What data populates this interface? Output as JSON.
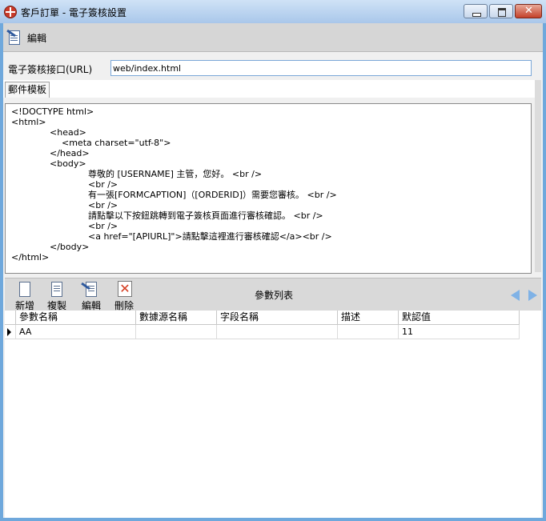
{
  "window": {
    "title": "客戶訂單 - 電子簽核設置"
  },
  "toolbar": {
    "edit_label": "編輯"
  },
  "url": {
    "label": "電子簽核接口(URL)",
    "value": "web/index.html"
  },
  "tabs": [
    {
      "label": "郵件模板"
    }
  ],
  "template_lines": [
    "<!DOCTYPE html>",
    "<html>",
    "<head>",
    "<meta charset=\"utf-8\">",
    "</head>",
    "<body>",
    "尊敬的 [USERNAME] 主管，您好。 <br />",
    "<br />",
    "有一張[FORMCAPTION]（[ORDERID]）需要您審核。 <br />",
    "<br />",
    "請點擊以下按鈕跳轉到電子簽核頁面進行審核確認。 <br />",
    "<br />",
    "<a href=\"[APIURL]\">請點擊這裡進行審核確認</a><br />",
    "</body>",
    "</html>"
  ],
  "params": {
    "toolbar": {
      "add": "新增",
      "copy": "複製",
      "edit": "編輯",
      "delete": "刪除"
    },
    "title": "參數列表",
    "columns": [
      "參數名稱",
      "數據源名稱",
      "字段名稱",
      "描述",
      "默認值"
    ],
    "rows": [
      [
        "AA",
        "",
        "",
        "",
        "11"
      ]
    ]
  }
}
